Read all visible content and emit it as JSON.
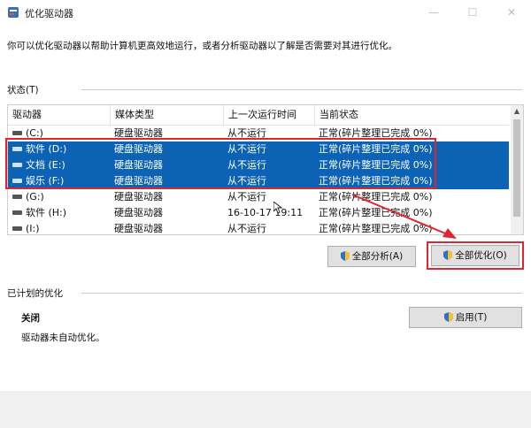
{
  "window": {
    "title": "优化驱动器"
  },
  "description": "你可以优化驱动器以帮助计算机更高效地运行，或者分析驱动器以了解是否需要对其进行优化。",
  "status_section": {
    "label": "状态(T)"
  },
  "table": {
    "columns": [
      "驱动器",
      "媒体类型",
      "上一次运行时间",
      "当前状态"
    ],
    "rows": [
      {
        "drive": "(C:)",
        "media": "硬盘驱动器",
        "last_run": "从不运行",
        "status": "正常(碎片整理已完成 0%)",
        "selected": false
      },
      {
        "drive": "软件 (D:)",
        "media": "硬盘驱动器",
        "last_run": "从不运行",
        "status": "正常(碎片整理已完成 0%)",
        "selected": true
      },
      {
        "drive": "文档 (E:)",
        "media": "硬盘驱动器",
        "last_run": "从不运行",
        "status": "正常(碎片整理已完成 0%)",
        "selected": true
      },
      {
        "drive": "娱乐 (F:)",
        "media": "硬盘驱动器",
        "last_run": "从不运行",
        "status": "正常(碎片整理已完成 0%)",
        "selected": true
      },
      {
        "drive": "(G:)",
        "media": "硬盘驱动器",
        "last_run": "从不运行",
        "status": "正常(碎片整理已完成 0%)",
        "selected": false
      },
      {
        "drive": "软件 (H:)",
        "media": "硬盘驱动器",
        "last_run": "16-10-17 19:11",
        "status": "正常(碎片整理已完成 0%)",
        "selected": false
      },
      {
        "drive": "(I:)",
        "media": "硬盘驱动器",
        "last_run": "从不运行",
        "status": "正常(碎片整理已完成 0%)",
        "selected": false
      }
    ]
  },
  "buttons": {
    "analyze_all": "全部分析(A)",
    "optimize_all": "全部优化(O)",
    "enable": "启用(T)"
  },
  "scheduled": {
    "label": "已计划的优化",
    "state": "关闭",
    "detail": "驱动器未自动优化。"
  },
  "colors": {
    "selection": "#0c62b5",
    "annotation": "#e0262c"
  }
}
